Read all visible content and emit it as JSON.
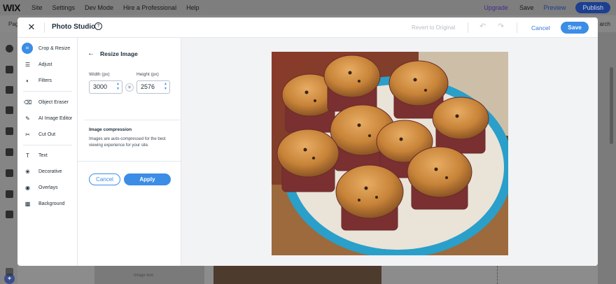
{
  "editor": {
    "logo": "WIX",
    "menu": [
      "Site",
      "Settings",
      "Dev Mode",
      "Hire a Professional",
      "Help"
    ],
    "upgrade": "Upgrade",
    "save": "Save",
    "preview": "Preview",
    "publish": "Publish",
    "pages_label": "Pag",
    "search_label": "arch",
    "ai_icon": "sparkle-icon",
    "bg_text": "Image text"
  },
  "modal": {
    "title": "Photo Studio",
    "help_icon": "help-circle-icon",
    "revert": "Revert to Original",
    "cancel": "Cancel",
    "save": "Save"
  },
  "tools": [
    {
      "label": "Crop & Resize",
      "icon": "crop-icon",
      "active": true
    },
    {
      "label": "Adjust",
      "icon": "sliders-icon"
    },
    {
      "label": "Filters",
      "icon": "filters-icon"
    },
    {
      "label": "Object Eraser",
      "icon": "eraser-icon"
    },
    {
      "label": "AI Image Editor",
      "icon": "ai-brush-icon"
    },
    {
      "label": "Cut Out",
      "icon": "scissors-icon"
    },
    {
      "label": "Text",
      "icon": "text-icon"
    },
    {
      "label": "Decorative",
      "icon": "decorative-icon"
    },
    {
      "label": "Overlays",
      "icon": "overlays-icon"
    },
    {
      "label": "Background",
      "icon": "background-icon"
    }
  ],
  "resize": {
    "title": "Resize Image",
    "width_label": "Width (px)",
    "height_label": "Height (px)",
    "width_value": "3000",
    "height_value": "2576",
    "compression_title": "Image compression",
    "compression_text": "Images are auto-compressed for the best viewing experience for your site.",
    "cancel": "Cancel",
    "apply": "Apply"
  },
  "colors": {
    "accent": "#3b8de6",
    "publish": "#1d3f8f"
  },
  "canvas": {
    "image_subject": "banana chocolate chip muffins on a blue-rimmed plate"
  }
}
